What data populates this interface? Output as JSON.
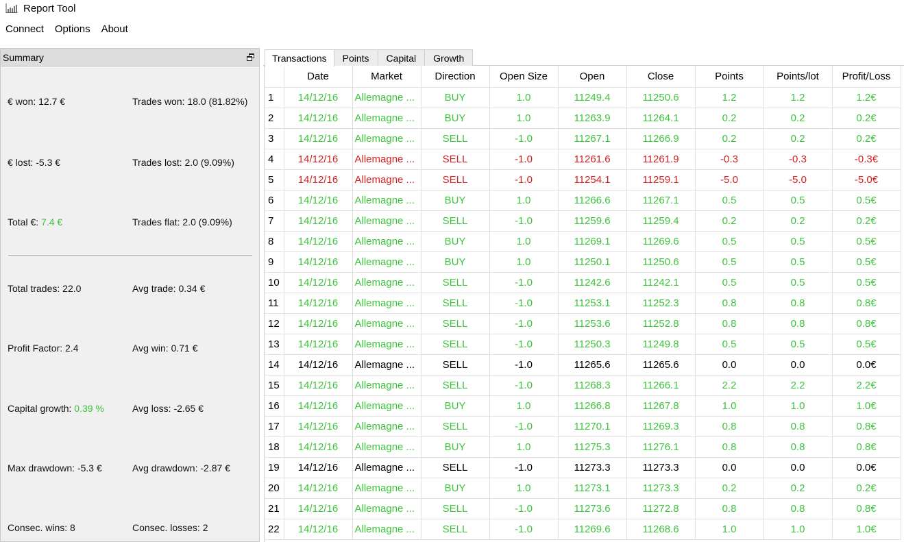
{
  "window": {
    "title": "Report Tool",
    "icon": "chart-icon"
  },
  "menu": [
    "Connect",
    "Options",
    "About"
  ],
  "summary": {
    "title": "Summary",
    "won_label": "€ won:",
    "won_value": "12.7 €",
    "trades_won_label": "Trades won:",
    "trades_won_value": "18.0 (81.82%)",
    "lost_label": "€ lost:",
    "lost_value": "-5.3 €",
    "trades_lost_label": "Trades lost:",
    "trades_lost_value": "2.0 (9.09%)",
    "total_label": "Total €:",
    "total_value": "7.4 €",
    "trades_flat_label": "Trades flat:",
    "trades_flat_value": "2.0 (9.09%)",
    "total_trades_label": "Total trades:",
    "total_trades_value": "22.0",
    "avg_trade_label": "Avg trade:",
    "avg_trade_value": "0.34 €",
    "profit_factor_label": "Profit Factor:",
    "profit_factor_value": "2.4",
    "avg_win_label": "Avg win:",
    "avg_win_value": "0.71 €",
    "capital_growth_label": "Capital growth:",
    "capital_growth_value": "0.39 %",
    "avg_loss_label": "Avg loss:",
    "avg_loss_value": "-2.65 €",
    "max_drawdown_label": "Max drawdown:",
    "max_drawdown_value": "-5.3 €",
    "avg_drawdown_label": "Avg drawdown:",
    "avg_drawdown_value": "-2.87 €",
    "consec_wins_label": "Consec. wins:",
    "consec_wins_value": "8",
    "consec_losses_label": "Consec. losses:",
    "consec_losses_value": "2"
  },
  "tabs": [
    "Transactions",
    "Points",
    "Capital",
    "Growth"
  ],
  "active_tab": "Transactions",
  "colors": {
    "win": "#3cc43c",
    "loss": "#d42020",
    "flat": "#000000"
  },
  "table": {
    "columns": [
      "Date",
      "Market",
      "Direction",
      "Open Size",
      "Open",
      "Close",
      "Points",
      "Points/lot",
      "Profit/Loss"
    ],
    "rows": [
      {
        "n": "1",
        "status": "win",
        "cells": [
          "14/12/16",
          "Allemagne ...",
          "BUY",
          "1.0",
          "11249.4",
          "11250.6",
          "1.2",
          "1.2",
          "1.2€"
        ]
      },
      {
        "n": "2",
        "status": "win",
        "cells": [
          "14/12/16",
          "Allemagne ...",
          "BUY",
          "1.0",
          "11263.9",
          "11264.1",
          "0.2",
          "0.2",
          "0.2€"
        ]
      },
      {
        "n": "3",
        "status": "win",
        "cells": [
          "14/12/16",
          "Allemagne ...",
          "SELL",
          "-1.0",
          "11267.1",
          "11266.9",
          "0.2",
          "0.2",
          "0.2€"
        ]
      },
      {
        "n": "4",
        "status": "loss",
        "cells": [
          "14/12/16",
          "Allemagne ...",
          "SELL",
          "-1.0",
          "11261.6",
          "11261.9",
          "-0.3",
          "-0.3",
          "-0.3€"
        ]
      },
      {
        "n": "5",
        "status": "loss",
        "cells": [
          "14/12/16",
          "Allemagne ...",
          "SELL",
          "-1.0",
          "11254.1",
          "11259.1",
          "-5.0",
          "-5.0",
          "-5.0€"
        ]
      },
      {
        "n": "6",
        "status": "win",
        "cells": [
          "14/12/16",
          "Allemagne ...",
          "BUY",
          "1.0",
          "11266.6",
          "11267.1",
          "0.5",
          "0.5",
          "0.5€"
        ]
      },
      {
        "n": "7",
        "status": "win",
        "cells": [
          "14/12/16",
          "Allemagne ...",
          "SELL",
          "-1.0",
          "11259.6",
          "11259.4",
          "0.2",
          "0.2",
          "0.2€"
        ]
      },
      {
        "n": "8",
        "status": "win",
        "cells": [
          "14/12/16",
          "Allemagne ...",
          "BUY",
          "1.0",
          "11269.1",
          "11269.6",
          "0.5",
          "0.5",
          "0.5€"
        ]
      },
      {
        "n": "9",
        "status": "win",
        "cells": [
          "14/12/16",
          "Allemagne ...",
          "BUY",
          "1.0",
          "11250.1",
          "11250.6",
          "0.5",
          "0.5",
          "0.5€"
        ]
      },
      {
        "n": "10",
        "status": "win",
        "cells": [
          "14/12/16",
          "Allemagne ...",
          "SELL",
          "-1.0",
          "11242.6",
          "11242.1",
          "0.5",
          "0.5",
          "0.5€"
        ]
      },
      {
        "n": "11",
        "status": "win",
        "cells": [
          "14/12/16",
          "Allemagne ...",
          "SELL",
          "-1.0",
          "11253.1",
          "11252.3",
          "0.8",
          "0.8",
          "0.8€"
        ]
      },
      {
        "n": "12",
        "status": "win",
        "cells": [
          "14/12/16",
          "Allemagne ...",
          "SELL",
          "-1.0",
          "11253.6",
          "11252.8",
          "0.8",
          "0.8",
          "0.8€"
        ]
      },
      {
        "n": "13",
        "status": "win",
        "cells": [
          "14/12/16",
          "Allemagne ...",
          "SELL",
          "-1.0",
          "11250.3",
          "11249.8",
          "0.5",
          "0.5",
          "0.5€"
        ]
      },
      {
        "n": "14",
        "status": "flat",
        "cells": [
          "14/12/16",
          "Allemagne ...",
          "SELL",
          "-1.0",
          "11265.6",
          "11265.6",
          "0.0",
          "0.0",
          "0.0€"
        ]
      },
      {
        "n": "15",
        "status": "win",
        "cells": [
          "14/12/16",
          "Allemagne ...",
          "SELL",
          "-1.0",
          "11268.3",
          "11266.1",
          "2.2",
          "2.2",
          "2.2€"
        ]
      },
      {
        "n": "16",
        "status": "win",
        "cells": [
          "14/12/16",
          "Allemagne ...",
          "BUY",
          "1.0",
          "11266.8",
          "11267.8",
          "1.0",
          "1.0",
          "1.0€"
        ]
      },
      {
        "n": "17",
        "status": "win",
        "cells": [
          "14/12/16",
          "Allemagne ...",
          "SELL",
          "-1.0",
          "11270.1",
          "11269.3",
          "0.8",
          "0.8",
          "0.8€"
        ]
      },
      {
        "n": "18",
        "status": "win",
        "cells": [
          "14/12/16",
          "Allemagne ...",
          "BUY",
          "1.0",
          "11275.3",
          "11276.1",
          "0.8",
          "0.8",
          "0.8€"
        ]
      },
      {
        "n": "19",
        "status": "flat",
        "cells": [
          "14/12/16",
          "Allemagne ...",
          "SELL",
          "-1.0",
          "11273.3",
          "11273.3",
          "0.0",
          "0.0",
          "0.0€"
        ]
      },
      {
        "n": "20",
        "status": "win",
        "cells": [
          "14/12/16",
          "Allemagne ...",
          "BUY",
          "1.0",
          "11273.1",
          "11273.3",
          "0.2",
          "0.2",
          "0.2€"
        ]
      },
      {
        "n": "21",
        "status": "win",
        "cells": [
          "14/12/16",
          "Allemagne ...",
          "SELL",
          "-1.0",
          "11273.6",
          "11272.8",
          "0.8",
          "0.8",
          "0.8€"
        ]
      },
      {
        "n": "22",
        "status": "win",
        "cells": [
          "14/12/16",
          "Allemagne ...",
          "SELL",
          "-1.0",
          "11269.6",
          "11268.6",
          "1.0",
          "1.0",
          "1.0€"
        ]
      }
    ]
  }
}
